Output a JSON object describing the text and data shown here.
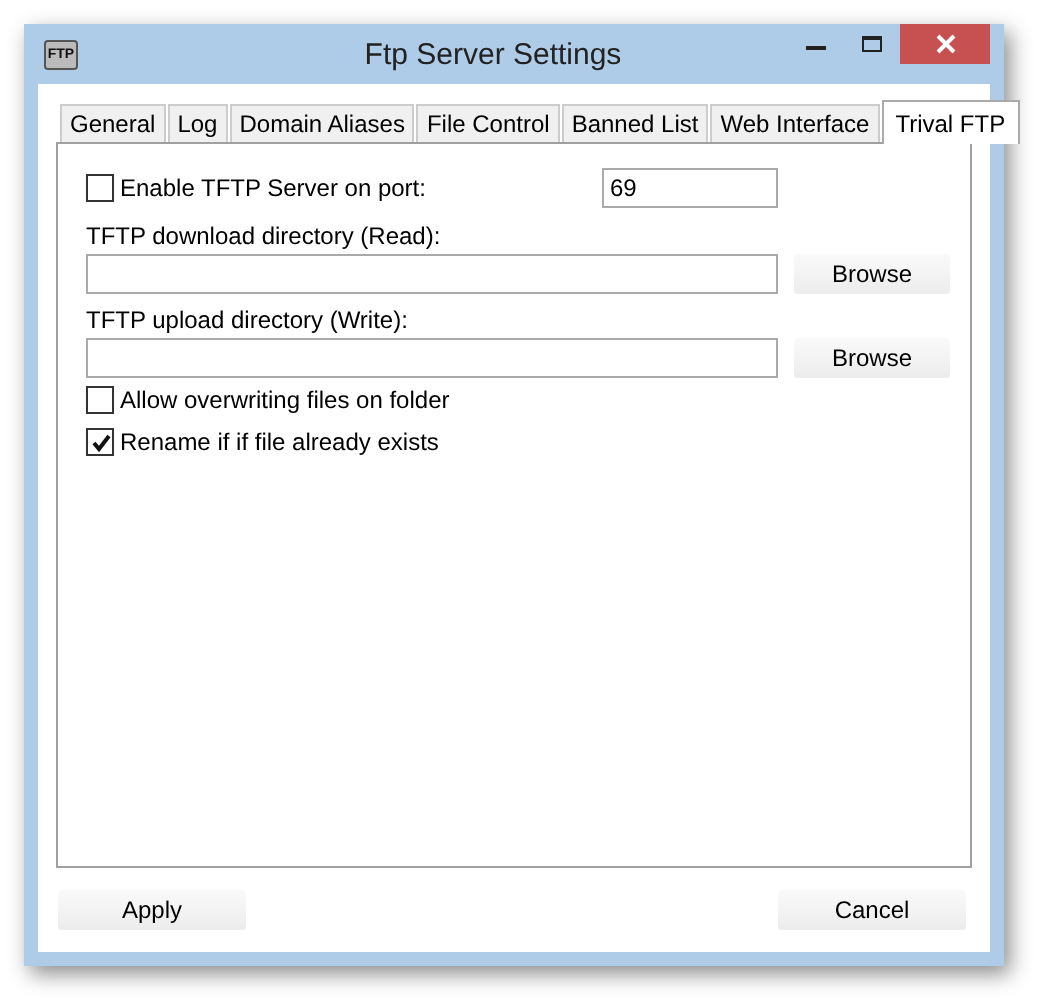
{
  "window": {
    "title": "Ftp Server Settings",
    "icon_label": "FTP"
  },
  "tabs": [
    {
      "label": "General",
      "selected": false
    },
    {
      "label": "Log",
      "selected": false
    },
    {
      "label": "Domain Aliases",
      "selected": false
    },
    {
      "label": "File Control",
      "selected": false
    },
    {
      "label": "Banned List",
      "selected": false
    },
    {
      "label": "Web Interface",
      "selected": false
    },
    {
      "label": "Trival FTP",
      "selected": true
    }
  ],
  "port": {
    "label": "Enable TFTP Server on port:",
    "checked": false,
    "value": "69"
  },
  "directories": [
    {
      "label": "TFTP download directory (Read):",
      "button": "Browse"
    },
    {
      "label": "TFTP upload directory (Write):",
      "button": "Browse"
    }
  ],
  "options": [
    {
      "label": "Allow overwriting files on folder",
      "checked": false
    },
    {
      "label": "Rename if if file already exists",
      "checked": true
    }
  ],
  "buttons": [
    "Apply",
    "Cancel"
  ]
}
